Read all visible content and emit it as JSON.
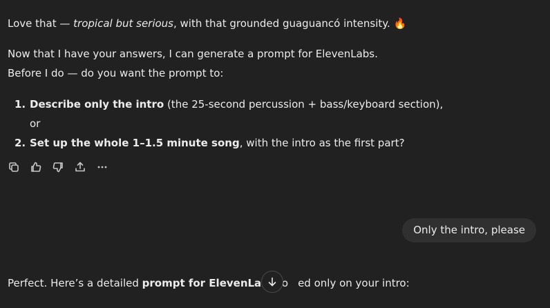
{
  "assistant_message_1": {
    "line1_prefix": "Love that — ",
    "line1_italic": "tropical but serious",
    "line1_suffix": ", with that grounded guaguancó intensity. ",
    "line1_emoji": "🔥",
    "line2": "Now that I have your answers, I can generate a prompt for ElevenLabs.",
    "line3": "Before I do — do you want the prompt to:",
    "options": [
      {
        "number": "1.",
        "bold": "Describe only the intro",
        "rest": " (the 25-second percussion + bass/keyboard section),"
      },
      {
        "number": "2.",
        "bold": "Set up the whole 1–1.5 minute song",
        "rest": ", with the intro as the first part?"
      }
    ],
    "or_text": "or"
  },
  "message_actions": {
    "icons": [
      "copy-icon",
      "thumbs-up-icon",
      "thumbs-down-icon",
      "share-icon",
      "more-icon"
    ]
  },
  "user_message": {
    "text": "Only the intro, please"
  },
  "assistant_message_2": {
    "prefix": "Perfect. Here’s a detailed ",
    "bold": "prompt for ElevenLabs",
    "suffix_visible_1": " fo",
    "suffix_visible_2": "ed only on your intro:"
  },
  "scroll_button": {
    "icon": "arrow-down-icon"
  }
}
